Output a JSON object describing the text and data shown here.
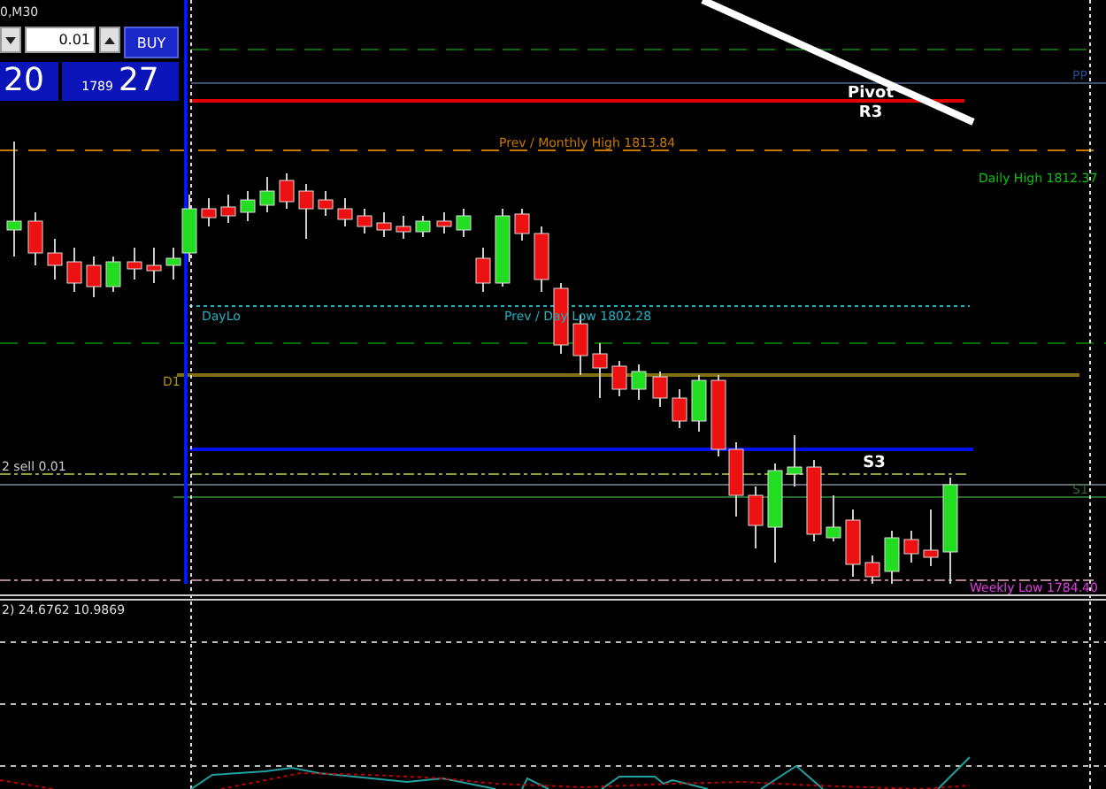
{
  "chart_title": "0,M30",
  "trade_panel": {
    "lot": "0.01",
    "buy_button": "BUY",
    "sell_price": "20",
    "buy_price_prefix": "1789",
    "buy_price_big": "27"
  },
  "labels": {
    "pp": "PP",
    "pivot": "Pivot",
    "r3": "R3",
    "monthly_high": "Prev / Monthly High 1813.84",
    "daily_high": "Daily High 1812.37",
    "day_lo": "DayLo",
    "prev_day_low": "Prev / Day Low 1802.28",
    "d1": "D1",
    "sell_order": "2 sell 0.01",
    "s3": "S3",
    "s1": "S1",
    "weekly_low": "Weekly Low 1784.40"
  },
  "indicator_readout": "2) 24.6762 10.9869"
}
